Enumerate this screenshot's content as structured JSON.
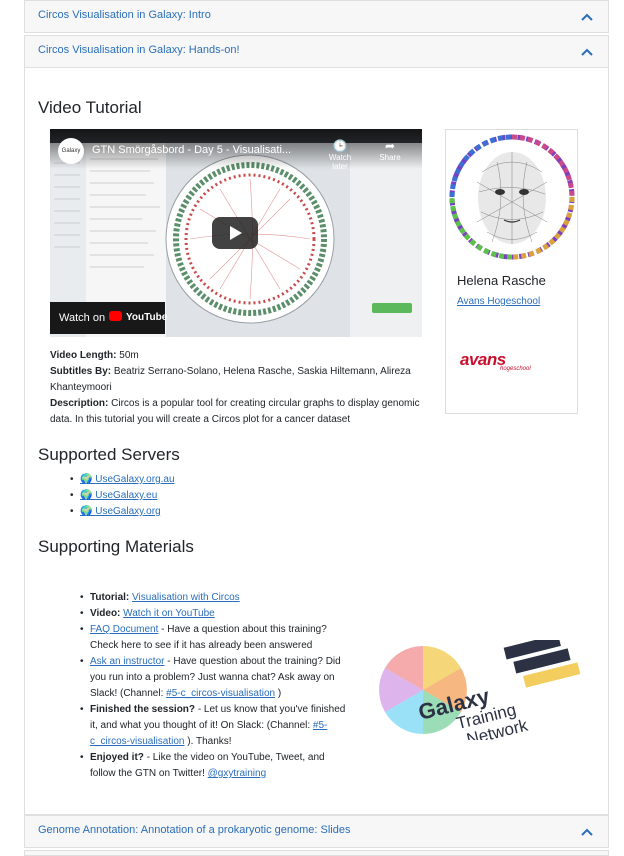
{
  "accordion_top": [
    {
      "label": "Circos Visualisation in Galaxy: Intro"
    },
    {
      "label": "Circos Visualisation in Galaxy: Hands-on!"
    }
  ],
  "accordion_bottom": {
    "label": "Genome Annotation: Annotation of a prokaryotic genome: Slides"
  },
  "video_section": {
    "heading": "Video Tutorial",
    "player": {
      "title": "GTN Smörgåsbord - Day 5 - Visualisati...",
      "watch_later": "Watch later",
      "share": "Share",
      "watch_on": "Watch on",
      "youtube": "YouTube"
    },
    "length_label": "Video Length:",
    "length_value": "50m",
    "subtitles_label": "Subtitles By:",
    "subtitles_value": "Beatriz Serrano-Solano, Helena Rasche, Saskia Hiltemann, Alireza Khanteymoori",
    "description_label": "Description:",
    "description_value": "Circos is a popular tool for creating circular graphs to display genomic data. In this tutorial you will create a Circos plot for a cancer dataset"
  },
  "author_card": {
    "name": "Helena Rasche",
    "affiliation": "Avans Hogeschool",
    "logo_text": "avans",
    "logo_sub": "hogeschool"
  },
  "servers": {
    "heading": "Supported Servers",
    "items": [
      "UseGalaxy.org.au",
      "UseGalaxy.eu",
      "UseGalaxy.org"
    ]
  },
  "materials": {
    "heading": "Supporting Materials",
    "tutorial_label": "Tutorial:",
    "tutorial_link": "Visualisation with Circos",
    "video_label": "Video:",
    "video_link": "Watch it on YouTube",
    "faq_link": "FAQ Document",
    "faq_text": "- Have a question about this training? Check here to see if it has already been answered",
    "ask_link": "Ask an instructor",
    "ask_text": "- Have question about the training? Did you run into a problem? Just wanna chat? Ask away on Slack! (Channel:",
    "ask_channel": "#5-c_circos-visualisation",
    "ask_close": ")",
    "finished_label": "Finished the session?",
    "finished_text": "- Let us know that you've finished it, and what you thought of it! On Slack: (Channel:",
    "finished_channel": "#5-c_circos-visualisation",
    "finished_close": "). Thanks!",
    "enjoyed_label": "Enjoyed it?",
    "enjoyed_text": "- Like the video on YouTube, Tweet, and follow the GTN on Twitter!",
    "twitter_link": "@gxytraining",
    "gtn_logo": {
      "line1": "Galaxy",
      "line2": "Training",
      "line3": "Network"
    }
  },
  "colors": {
    "link": "#2a6ebb",
    "accordion_bg": "#f7f7f7"
  }
}
